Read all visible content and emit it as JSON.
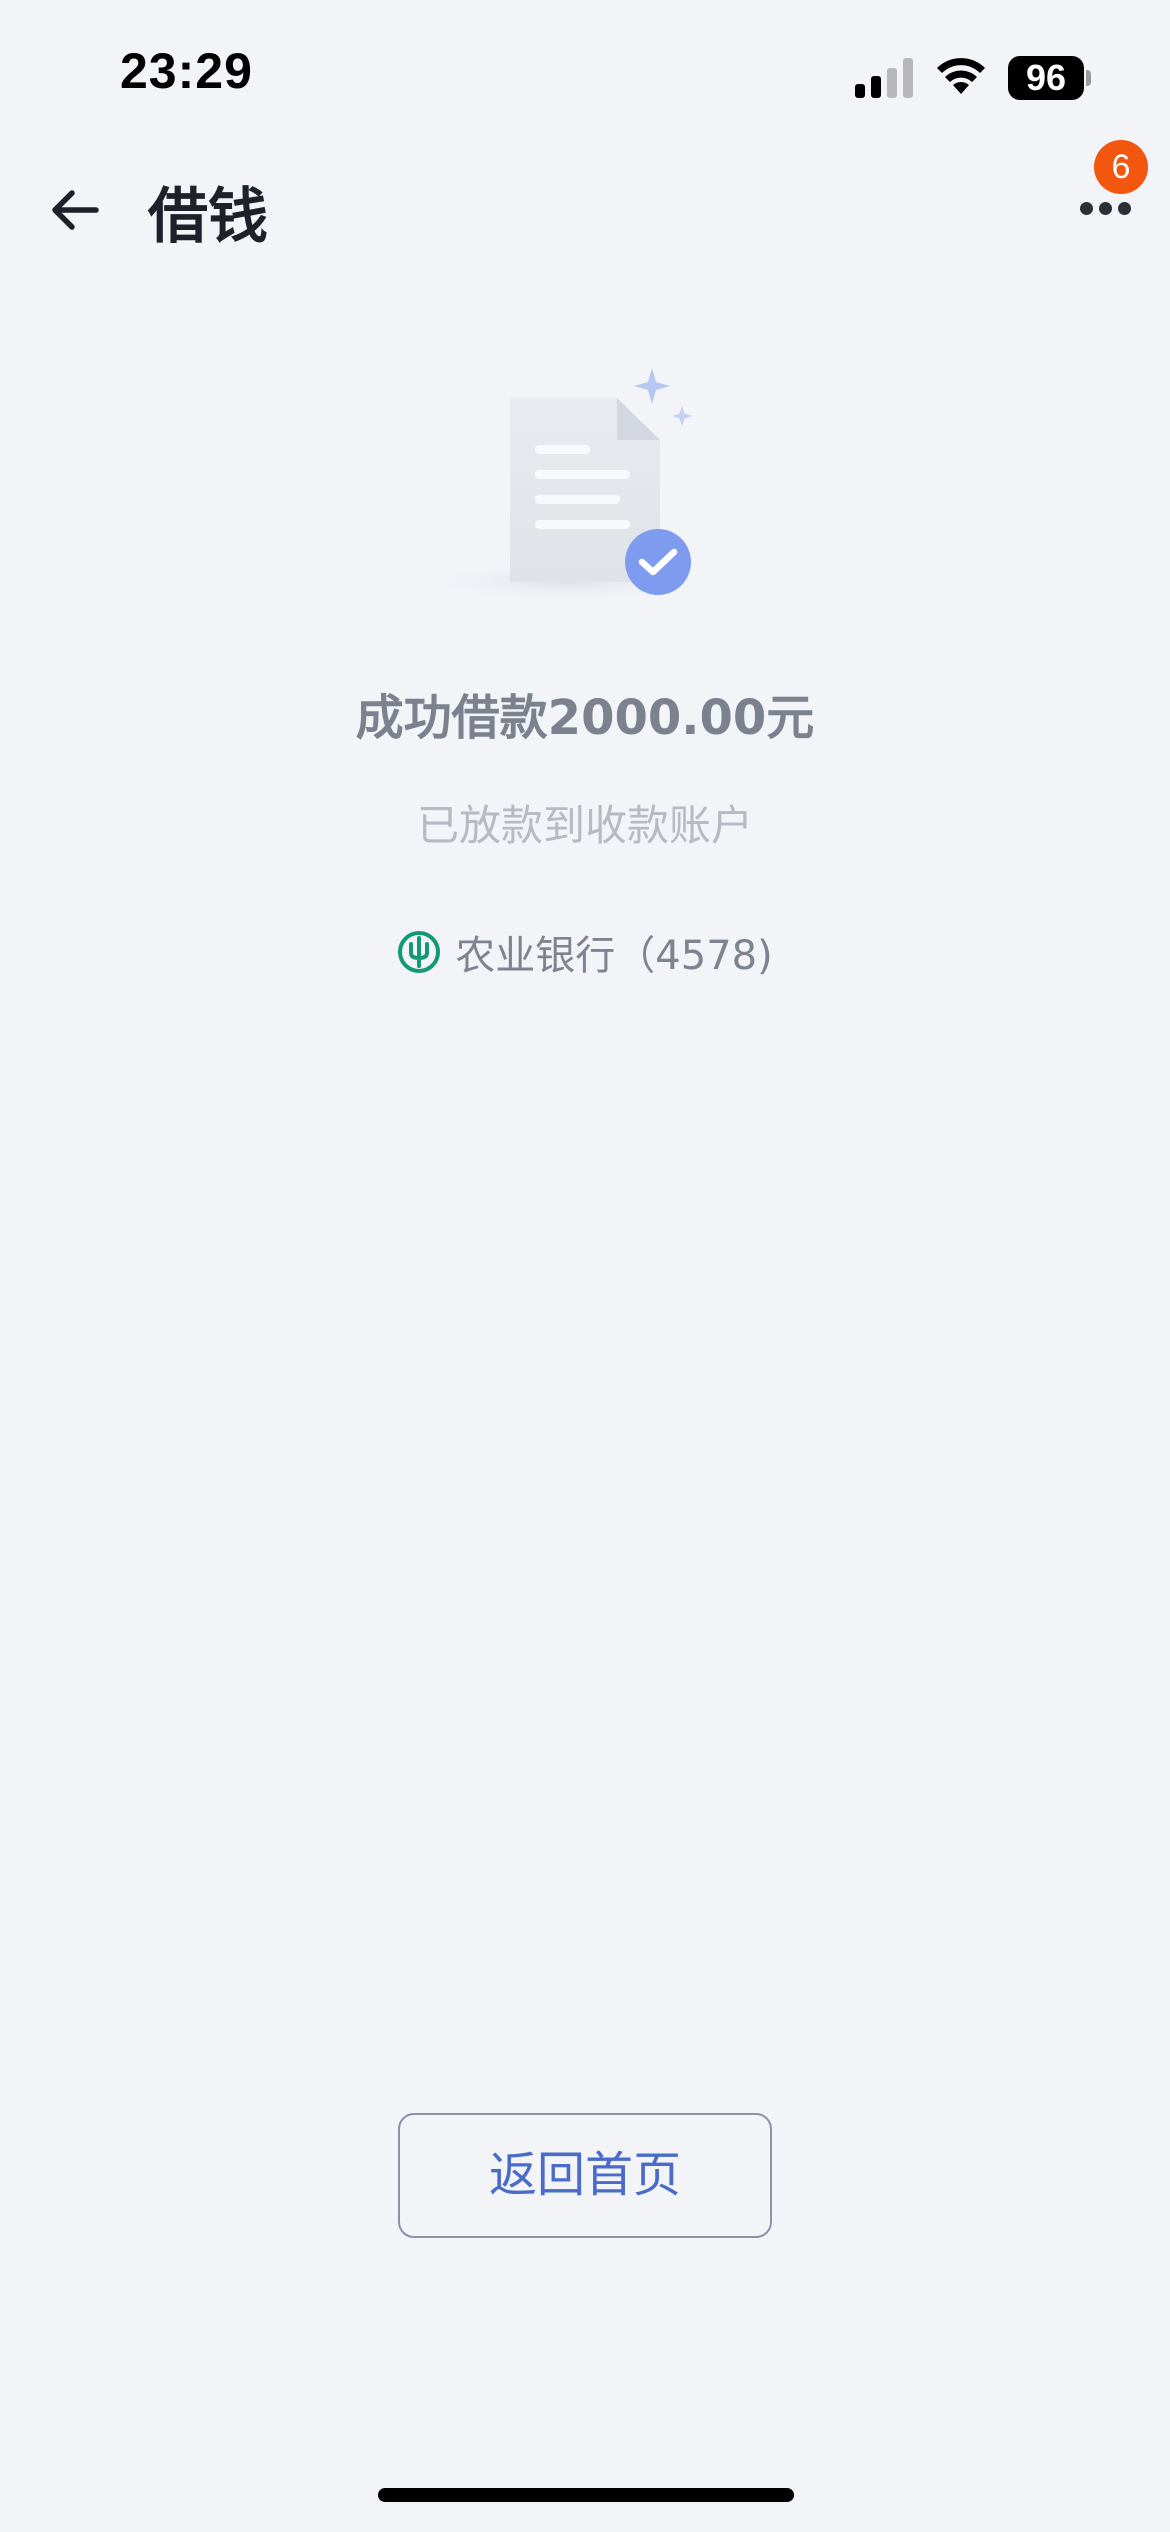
{
  "status_bar": {
    "time": "23:29",
    "battery": "96",
    "icons": [
      "signal-icon",
      "wifi-icon",
      "battery-icon"
    ]
  },
  "nav": {
    "title": "借钱",
    "back_icon": "arrow-left-icon",
    "more_icon": "more-dots-icon",
    "badge_count": "6",
    "badge_color": "#f2560f"
  },
  "result": {
    "illustration": "document-check-icon",
    "title": "成功借款2000.00元",
    "subtitle": "已放款到收款账户",
    "bank_name": "农业银行",
    "bank_account": "（4578)",
    "bank_logo": "abc-bank-logo",
    "bank_color": "#139a74"
  },
  "actions": {
    "home_label": "返回首页",
    "accent": "#4a6bc9"
  }
}
